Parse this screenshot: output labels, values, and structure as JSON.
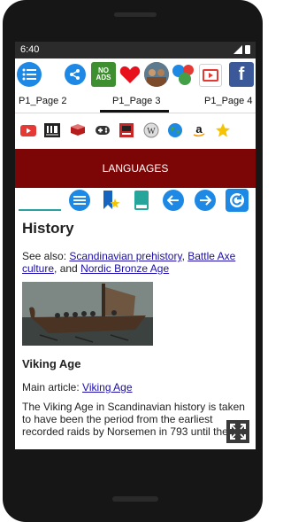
{
  "status": {
    "time": "6:40"
  },
  "toolbar": {
    "no_ads_label_1": "NO",
    "no_ads_label_2": "ADS",
    "facebook_letter": "f"
  },
  "tabs": [
    {
      "label": "P1_Page 2"
    },
    {
      "label": "P1_Page 3"
    },
    {
      "label": "P1_Page 4"
    }
  ],
  "banner": {
    "label": "LANGUAGES"
  },
  "article": {
    "title": "History",
    "see_also_prefix": "See also: ",
    "see_also_link1": "Scandinavian prehistory",
    "see_also_sep1": ", ",
    "see_also_link2": "Battle Axe culture",
    "see_also_sep2": ", and ",
    "see_also_link3": "Nordic Bronze Age",
    "section_title": "Viking Age",
    "main_article_prefix": "Main article: ",
    "main_article_link": "Viking Age",
    "body": "The Viking Age in Scandinavian history is taken to have been the period from the earliest recorded raids by Norsemen in 793 until the"
  },
  "colors": {
    "banner": "#7c0606",
    "accent_blue": "#1e88e5"
  }
}
